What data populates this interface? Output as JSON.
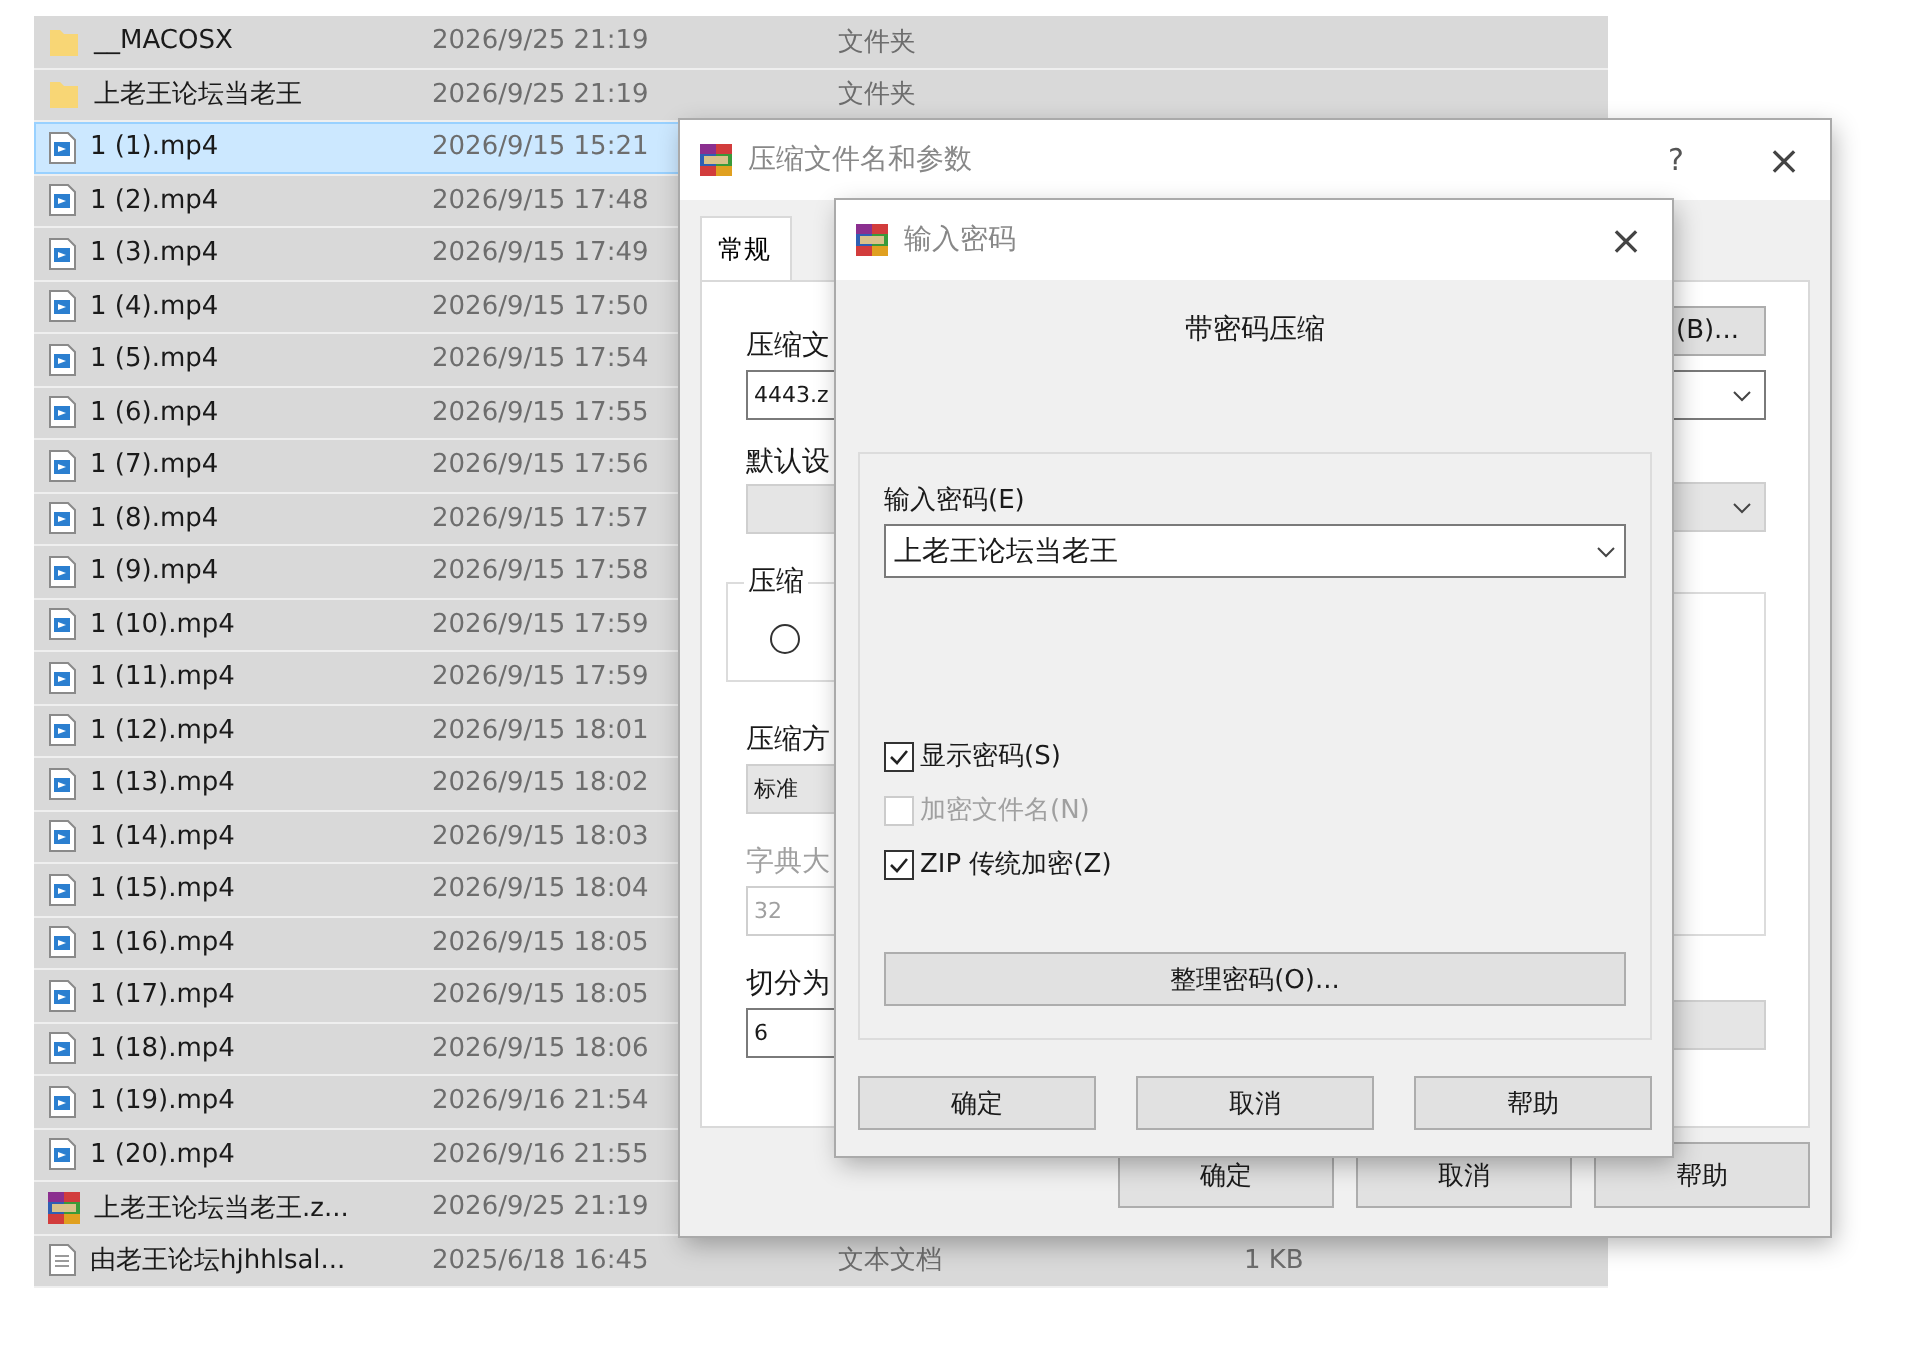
{
  "files": [
    {
      "kind": "folder",
      "name": "__MACOSX",
      "date": "2026/9/25 21:19",
      "type": "文件夹",
      "selected": false
    },
    {
      "kind": "folder",
      "name": "上老王论坛当老王",
      "date": "2026/9/25 21:19",
      "type": "文件夹",
      "selected": false
    },
    {
      "kind": "video",
      "name": "1 (1).mp4",
      "date": "2026/9/15 15:21",
      "selected": true
    },
    {
      "kind": "video",
      "name": "1 (2).mp4",
      "date": "2026/9/15 17:48",
      "selected": false
    },
    {
      "kind": "video",
      "name": "1 (3).mp4",
      "date": "2026/9/15 17:49",
      "selected": false
    },
    {
      "kind": "video",
      "name": "1 (4).mp4",
      "date": "2026/9/15 17:50",
      "selected": false
    },
    {
      "kind": "video",
      "name": "1 (5).mp4",
      "date": "2026/9/15 17:54",
      "selected": false
    },
    {
      "kind": "video",
      "name": "1 (6).mp4",
      "date": "2026/9/15 17:55",
      "selected": false
    },
    {
      "kind": "video",
      "name": "1 (7).mp4",
      "date": "2026/9/15 17:56",
      "selected": false
    },
    {
      "kind": "video",
      "name": "1 (8).mp4",
      "date": "2026/9/15 17:57",
      "selected": false
    },
    {
      "kind": "video",
      "name": "1 (9).mp4",
      "date": "2026/9/15 17:58",
      "selected": false
    },
    {
      "kind": "video",
      "name": "1 (10).mp4",
      "date": "2026/9/15 17:59",
      "selected": false
    },
    {
      "kind": "video",
      "name": "1 (11).mp4",
      "date": "2026/9/15 17:59",
      "selected": false
    },
    {
      "kind": "video",
      "name": "1 (12).mp4",
      "date": "2026/9/15 18:01",
      "selected": false
    },
    {
      "kind": "video",
      "name": "1 (13).mp4",
      "date": "2026/9/15 18:02",
      "selected": false
    },
    {
      "kind": "video",
      "name": "1 (14).mp4",
      "date": "2026/9/15 18:03",
      "selected": false
    },
    {
      "kind": "video",
      "name": "1 (15).mp4",
      "date": "2026/9/15 18:04",
      "selected": false
    },
    {
      "kind": "video",
      "name": "1 (16).mp4",
      "date": "2026/9/15 18:05",
      "selected": false
    },
    {
      "kind": "video",
      "name": "1 (17).mp4",
      "date": "2026/9/15 18:05",
      "selected": false
    },
    {
      "kind": "video",
      "name": "1 (18).mp4",
      "date": "2026/9/15 18:06",
      "selected": false
    },
    {
      "kind": "video",
      "name": "1 (19).mp4",
      "date": "2026/9/16 21:54",
      "selected": false
    },
    {
      "kind": "video",
      "name": "1 (20).mp4",
      "date": "2026/9/16 21:55",
      "selected": false
    },
    {
      "kind": "archive",
      "name": "上老王论坛当老王.z...",
      "date": "2026/9/25 21:19",
      "selected": false
    },
    {
      "kind": "text",
      "name": "由老王论坛hjhhlsal...",
      "date": "2025/6/18 16:45",
      "type": "文本文档",
      "size": "1 KB",
      "selected": false
    }
  ],
  "archive_dialog": {
    "title": "压缩文件名和参数",
    "help": "?",
    "close": "×",
    "tabs": [
      {
        "label": "常规",
        "selected": true
      }
    ],
    "left": {
      "archive_name_label": "压缩文",
      "archive_name": "4443.z",
      "profile_label": "默认设",
      "group_label": "压缩",
      "radio": {
        "selected": false
      },
      "method_label": "压缩方",
      "method": "标准",
      "dict_label": "字典大",
      "dict": "32",
      "split_label": "切分为",
      "split": "6"
    },
    "browse_button": "(B)...",
    "buttons": [
      "确定",
      "取消",
      "帮助"
    ]
  },
  "password_dialog": {
    "title": "输入密码",
    "close": "×",
    "heading": "带密码压缩",
    "password_label": "输入密码(E)",
    "password": "上老王论坛当老王",
    "options": [
      {
        "label": "显示密码(S)",
        "checked": true,
        "disabled": false
      },
      {
        "label": "加密文件名(N)",
        "checked": false,
        "disabled": true
      },
      {
        "label": "ZIP 传统加密(Z)",
        "checked": true,
        "disabled": false
      }
    ],
    "organize_button": "整理密码(O)...",
    "buttons": [
      "确定",
      "取消",
      "帮助"
    ]
  }
}
